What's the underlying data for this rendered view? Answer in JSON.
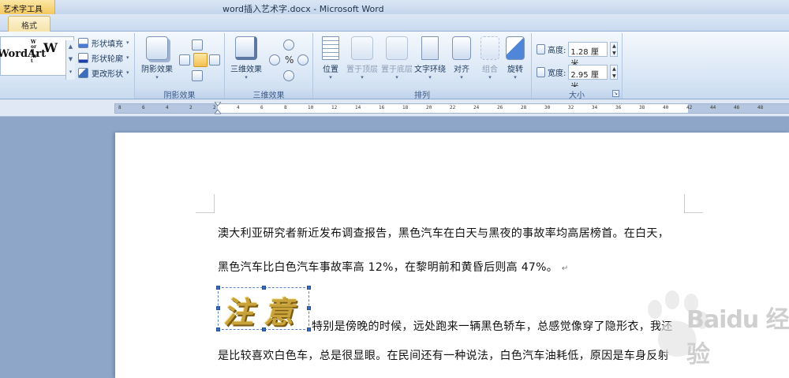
{
  "window": {
    "context_group": "艺术字工具",
    "title": "word插入艺术字.docx - Microsoft Word"
  },
  "tabs": {
    "active": "格式"
  },
  "ribbon": {
    "wordart_styles": {
      "gallery_items": [
        "WordArt",
        "WordArt",
        "W"
      ],
      "shape_fill": "形状填充",
      "shape_outline": "形状轮廓",
      "change_shape": "更改形状"
    },
    "shadow_effects": {
      "button": "阴影效果",
      "group_label": "阴影效果"
    },
    "three_d_effects": {
      "button": "三维效果",
      "group_label": "三维效果"
    },
    "arrange": {
      "position": "位置",
      "bring_to_front": "置于顶层",
      "send_to_back": "置于底层",
      "text_wrapping": "文字环绕",
      "align": "对齐",
      "group": "组合",
      "rotate": "旋转",
      "group_label": "排列"
    },
    "size": {
      "height_label": "高度:",
      "height_value": "1.28 厘米",
      "width_label": "宽度:",
      "width_value": "2.95 厘米",
      "group_label": "大小"
    }
  },
  "ruler": {
    "ticks": [
      "8",
      "6",
      "4",
      "2",
      "2",
      "4",
      "6",
      "8",
      "10",
      "12",
      "14",
      "16",
      "18",
      "20",
      "22",
      "24",
      "26",
      "28",
      "30",
      "32",
      "34",
      "36",
      "38",
      "40",
      "42",
      "44",
      "46",
      "48"
    ]
  },
  "document": {
    "line1": "澳大利亚研究者新近发布调查报告，黑色汽车在白天与黑夜的事故率均高居榜首。在白天，",
    "line2": "黑色汽车比白色汽车事故率高  12%，在黎明前和黄昏后则高  47%。",
    "line2_mark": "↵",
    "wordart_text": "注 意",
    "line3": "特别是傍晚的时候，远处跑来一辆黑色轿车，总感觉像穿了隐形衣，我还",
    "line4": "是比较喜欢白色车，总是很显眼。在民间还有一种说法，白色汽车油耗低，原因是车身反射"
  },
  "watermark": {
    "text": "Baidu 经验"
  },
  "colors": {
    "ribbon_bg": "#dce8f6",
    "context_tab": "#f4c860",
    "wordart_fill": "#c9a33a",
    "selection": "#3c6dbb"
  }
}
